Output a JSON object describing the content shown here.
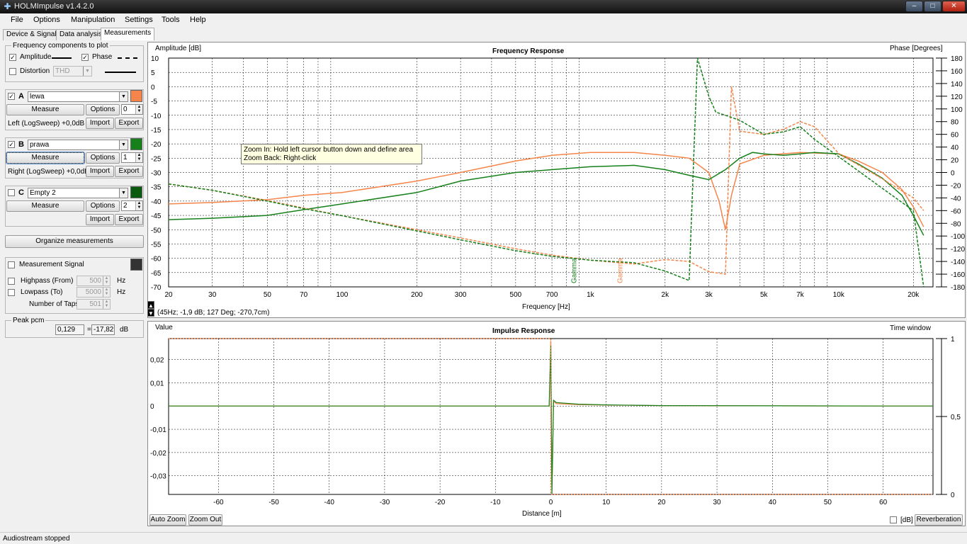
{
  "window": {
    "title": "HOLMImpulse  v1.4.2.0",
    "min": "–",
    "max": "□",
    "close": "✕"
  },
  "menu": [
    "File",
    "Options",
    "Manipulation",
    "Settings",
    "Tools",
    "Help"
  ],
  "tabs": [
    {
      "label": "Device & Signal"
    },
    {
      "label": "Data analysis"
    },
    {
      "label": "Measurements",
      "active": true
    }
  ],
  "components": {
    "title": "Frequency components to plot",
    "amplitude": "Amplitude",
    "phase": "Phase",
    "distortion": "Distortion",
    "distortion_type": "THD"
  },
  "measurements": [
    {
      "letter": "A",
      "name": "lewa",
      "checked": true,
      "color": "#f5854a",
      "measure": "Measure",
      "options": "Options",
      "index": "0",
      "info": "Left (LogSweep) +0,0dB",
      "import": "Import",
      "export": "Export"
    },
    {
      "letter": "B",
      "name": "prawa",
      "checked": true,
      "color": "#16801a",
      "measure": "Measure",
      "options": "Options",
      "index": "1",
      "info": "Right (LogSweep) +0,0dB",
      "import": "Import",
      "export": "Export"
    },
    {
      "letter": "C",
      "name": "Empty 2",
      "checked": false,
      "color": "#0a5a10",
      "measure": "Measure",
      "options": "Options",
      "index": "2",
      "info": "",
      "import": "Import",
      "export": "Export"
    }
  ],
  "organize": "Organize measurements",
  "signal": {
    "title": "Measurement Signal",
    "highpass": "Highpass (From)",
    "highpass_val": "500",
    "hz1": "Hz",
    "lowpass": "Lowpass (To)",
    "lowpass_val": "5000",
    "hz2": "Hz",
    "taps": "Number of Taps",
    "taps_val": "501"
  },
  "peak": {
    "label": "Peak pcm",
    "value": "0,129",
    "eq": "=",
    "db": "-17,82",
    "unit": "dB"
  },
  "tooltip": {
    "line1": "Zoom In:   Hold left cursor button down and define area",
    "line2": "Zoom Back: Right-click"
  },
  "freq": {
    "title": "Frequency Response",
    "ylabel": "Amplitude [dB]",
    "y2label": "Phase [Degrees]",
    "xlabel": "Frequency [Hz]",
    "cursor": "(45Hz; -1,9 dB; 127 Deg; -270,7cm)",
    "marker_a": "Gamma",
    "marker_b": "Gamma",
    "xticks": [
      "20",
      "30",
      "50",
      "70",
      "100",
      "200",
      "300",
      "500",
      "700",
      "1k",
      "2k",
      "3k",
      "5k",
      "7k",
      "10k",
      "20k"
    ],
    "yticks": [
      "10",
      "5",
      "0",
      "-5",
      "-10",
      "-15",
      "-20",
      "-25",
      "-30",
      "-35",
      "-40",
      "-45",
      "-50",
      "-55",
      "-60",
      "-65",
      "-70"
    ],
    "y2ticks": [
      "180",
      "160",
      "140",
      "120",
      "100",
      "80",
      "60",
      "40",
      "20",
      "0",
      "-20",
      "-40",
      "-60",
      "-80",
      "-100",
      "-120",
      "-140",
      "-160",
      "-180"
    ]
  },
  "impulse": {
    "title": "Impulse Response",
    "ylabel": "Value",
    "y2label": "Time window",
    "xlabel": "Distance [m]",
    "xticks": [
      "-60",
      "-50",
      "-40",
      "-30",
      "-20",
      "-10",
      "0",
      "10",
      "20",
      "30",
      "40",
      "50",
      "60"
    ],
    "yticks": [
      "0,02",
      "0,01",
      "0",
      "-0,01",
      "-0,02",
      "-0,03"
    ],
    "y2ticks": [
      "1",
      "0,5",
      "0"
    ]
  },
  "buttons": {
    "autozoom": "Auto Zoom",
    "zoomout": "Zoom Out",
    "db": "[dB]",
    "reverb": "Reverberation"
  },
  "status": "Audiostream stopped",
  "chart_data": [
    {
      "type": "line",
      "title": "Frequency Response",
      "xlabel": "Frequency [Hz]",
      "ylabel": "Amplitude [dB]",
      "y2label": "Phase [Degrees]",
      "xscale": "log",
      "xlim": [
        20,
        24000
      ],
      "ylim": [
        -70,
        10
      ],
      "y2lim": [
        -180,
        180
      ],
      "grid": true,
      "series": [
        {
          "name": "lewa",
          "kind": "amplitude",
          "color": "#f5854a",
          "dash": false,
          "x": [
            20,
            30,
            50,
            70,
            100,
            200,
            300,
            500,
            700,
            1000,
            1500,
            2000,
            2500,
            3000,
            3300,
            3500,
            3700,
            4000,
            5000,
            7000,
            10000,
            12000,
            15000,
            18000,
            20000,
            22000
          ],
          "y": [
            -41,
            -40.5,
            -39.5,
            -38,
            -37,
            -33,
            -30,
            -26,
            -24,
            -23,
            -23,
            -24,
            -25,
            -30,
            -40,
            -50,
            -38,
            -27,
            -24,
            -23,
            -23.5,
            -26,
            -30,
            -36,
            -42,
            -49
          ]
        },
        {
          "name": "prawa",
          "kind": "amplitude",
          "color": "#16801a",
          "dash": false,
          "x": [
            20,
            30,
            50,
            70,
            100,
            200,
            300,
            500,
            700,
            1000,
            1500,
            2000,
            2500,
            3000,
            3500,
            4000,
            4500,
            5000,
            6000,
            7000,
            8000,
            10000,
            12000,
            15000,
            18000,
            20000,
            22000
          ],
          "y": [
            -46.5,
            -46,
            -45,
            -43,
            -41,
            -37,
            -33,
            -30,
            -29,
            -28,
            -27.5,
            -29,
            -31,
            -32.5,
            -29,
            -25,
            -23,
            -23.5,
            -24,
            -23.5,
            -23,
            -23.5,
            -27,
            -32,
            -38,
            -45,
            -52
          ]
        },
        {
          "name": "lewa",
          "kind": "phase",
          "color": "#f5854a",
          "dash": true,
          "x": [
            20,
            30,
            50,
            70,
            100,
            200,
            300,
            500,
            700,
            1000,
            1500,
            2000,
            2500,
            3000,
            3500,
            3700,
            4000,
            5000,
            6000,
            7000,
            8000,
            10000,
            15000,
            20000,
            22000
          ],
          "y": [
            -18,
            -28,
            -44,
            -56,
            -68,
            -90,
            -103,
            -120,
            -130,
            -138,
            -144,
            -137,
            -140,
            -156,
            -160,
            135,
            65,
            60,
            68,
            80,
            72,
            30,
            -10,
            -40,
            -60
          ]
        },
        {
          "name": "prawa",
          "kind": "phase",
          "color": "#16801a",
          "dash": true,
          "x": [
            20,
            30,
            50,
            70,
            100,
            200,
            300,
            500,
            700,
            1000,
            1500,
            2000,
            2500,
            2700,
            3000,
            3200,
            3500,
            4000,
            5000,
            6000,
            7000,
            8000,
            10000,
            15000,
            20000,
            22000
          ],
          "y": [
            -18,
            -28,
            -45,
            -57,
            -68,
            -92,
            -106,
            -123,
            -132,
            -138,
            -142,
            -155,
            -170,
            180,
            120,
            95,
            90,
            82,
            60,
            64,
            72,
            52,
            25,
            -25,
            -60,
            -180
          ]
        }
      ]
    },
    {
      "type": "line",
      "title": "Impulse Response",
      "xlabel": "Distance [m]",
      "ylabel": "Value",
      "y2label": "Time window",
      "xlim": [
        -69,
        69
      ],
      "ylim": [
        -0.038,
        0.029
      ],
      "y2lim": [
        0,
        1
      ],
      "grid": true,
      "series": [
        {
          "name": "lewa",
          "color": "#f5854a",
          "x": [
            -69,
            -0.3,
            0,
            0.2,
            0.5,
            1,
            5,
            10,
            20,
            40,
            60,
            69
          ],
          "y": [
            0,
            0,
            0.028,
            -0.036,
            0.002,
            0.001,
            0.0006,
            0.0004,
            0.0002,
            0.0001,
            0,
            0
          ]
        },
        {
          "name": "prawa",
          "color": "#16801a",
          "x": [
            -69,
            -0.3,
            0,
            0.2,
            0.5,
            1,
            5,
            10,
            20,
            40,
            60,
            69
          ],
          "y": [
            0,
            0,
            0.026,
            -0.038,
            0.0025,
            0.0015,
            0.0008,
            0.0005,
            0.0002,
            0.0001,
            0,
            0
          ]
        },
        {
          "name": "Time window",
          "color": "#f5854a",
          "dash": true,
          "axis": "y2",
          "x": [
            -69,
            0,
            0,
            69
          ],
          "y": [
            1,
            1,
            0,
            0
          ]
        }
      ]
    }
  ]
}
